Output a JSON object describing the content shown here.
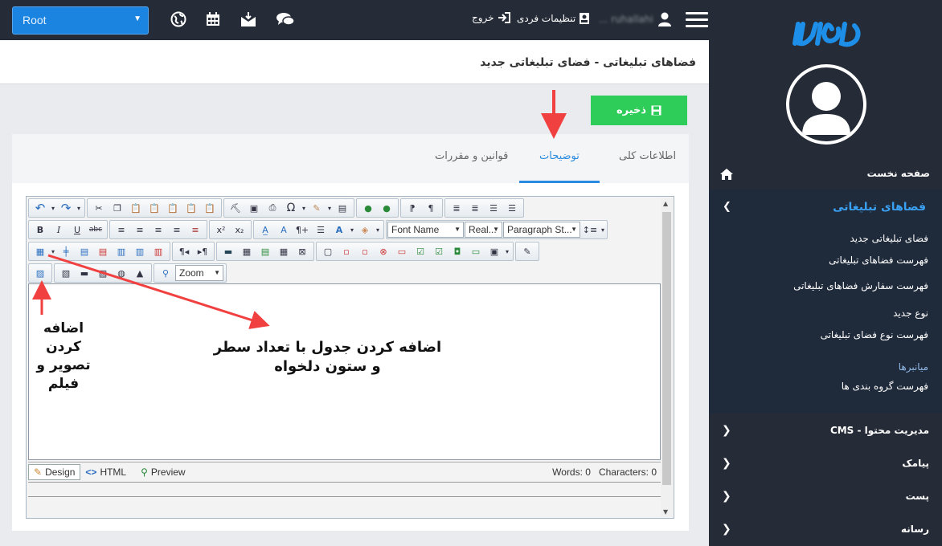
{
  "header": {
    "root_select": "Root",
    "user_name": "ruhallahi ...",
    "personal_settings": "تنظیمات فردی",
    "logout": "خروج"
  },
  "page": {
    "title": "فضاهای تبلیغاتی - فضای تبلیغاتی جدید",
    "save_label": "ذخیره"
  },
  "tabs": [
    {
      "label": "اطلاعات کلی"
    },
    {
      "label": "توضیحات"
    },
    {
      "label": "قوانین و مقررات"
    }
  ],
  "editor": {
    "font_name": "Font Name",
    "font_size": "Real...",
    "paragraph_style": "Paragraph St...",
    "zoom": "Zoom",
    "modes": {
      "design": "Design",
      "html": "HTML",
      "preview": "Preview"
    },
    "words": "Words: 0",
    "characters": "Characters: 0"
  },
  "annotations": {
    "add_image_line1": "اضافه کردن",
    "add_image_line2": "تصویر و",
    "add_image_line3": "فیلم",
    "add_table_line1": "اضافه کردن جدول با تعداد سطر",
    "add_table_line2": "و ستون دلخواه"
  },
  "sidebar": {
    "home": "صفحه نخست",
    "open_section": "فضاهای تبلیغاتی",
    "sub_items": [
      "فضای تبلیغاتی جدید",
      "فهرست فضاهای تبلیغاتی",
      "فهرست سفارش فضاهای تبلیغاتی",
      "نوع جدید",
      "فهرست نوع فضای تبلیغاتی",
      "میانبرها",
      "فهرست گروه بندی ها"
    ],
    "sections": [
      "مدیریت محتوا - CMS",
      "پیامک",
      "پست",
      "رسانه"
    ]
  },
  "colors": {
    "sidebar_bg": "#262c37",
    "accent_blue": "#2b8be0",
    "save_green": "#2ecc58",
    "annotation_red": "#f04040"
  }
}
